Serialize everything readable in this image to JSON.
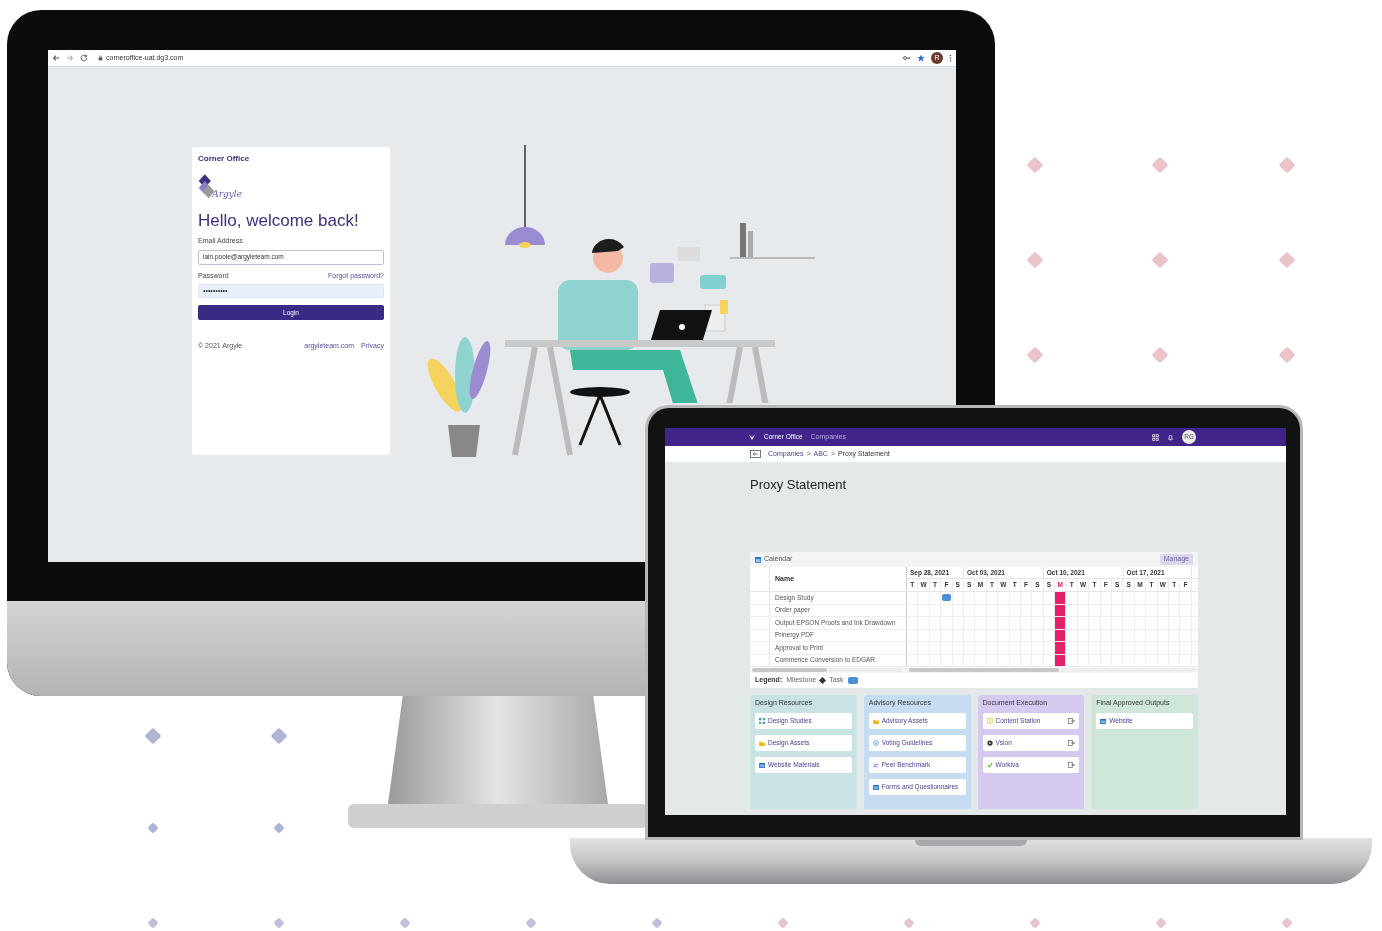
{
  "browser": {
    "url": "corneroffice-uat.dg3.com",
    "avatar": "R"
  },
  "login": {
    "brand": "Corner Office",
    "logo_text": "Argyle",
    "heading": "Hello, welcome back!",
    "email_label": "Email Address",
    "email_value": "iain.poole@argyleteam.com",
    "password_label": "Password",
    "forgot_link": "Forgot password?",
    "password_value": "••••••••••",
    "button": "Login",
    "copyright": "© 2021 Argyle",
    "footer_links": [
      "argyleteam.com",
      "Privacy"
    ]
  },
  "app": {
    "brand": "Corner Office",
    "nav": [
      "Companies"
    ],
    "avatar": "RG",
    "breadcrumbs": [
      "Companies",
      "ABC",
      "Proxy Statement"
    ],
    "separator": ">",
    "title": "Proxy Statement",
    "calendar": {
      "title": "Calendar",
      "manage_button": "Manage",
      "name_header": "Name",
      "weeks": [
        {
          "label": "Sep 28, 2021",
          "days": [
            {
              "letter": "T",
              "today": false
            },
            {
              "letter": "W",
              "today": false
            },
            {
              "letter": "T",
              "today": false
            },
            {
              "letter": "F",
              "today": false
            },
            {
              "letter": "S",
              "today": false
            }
          ]
        },
        {
          "label": "Oct 03, 2021",
          "days": [
            {
              "letter": "S",
              "today": false
            },
            {
              "letter": "M",
              "today": false
            },
            {
              "letter": "T",
              "today": false
            },
            {
              "letter": "W",
              "today": false
            },
            {
              "letter": "T",
              "today": false
            },
            {
              "letter": "F",
              "today": false
            },
            {
              "letter": "S",
              "today": false
            }
          ]
        },
        {
          "label": "Oct 10, 2021",
          "days": [
            {
              "letter": "S",
              "today": false
            },
            {
              "letter": "M",
              "today": true
            },
            {
              "letter": "T",
              "today": false
            },
            {
              "letter": "W",
              "today": false
            },
            {
              "letter": "T",
              "today": false
            },
            {
              "letter": "F",
              "today": false
            },
            {
              "letter": "S",
              "today": false
            }
          ]
        },
        {
          "label": "Oct 17, 2021",
          "days": [
            {
              "letter": "S",
              "today": false
            },
            {
              "letter": "M",
              "today": false
            },
            {
              "letter": "T",
              "today": false
            },
            {
              "letter": "W",
              "today": false
            },
            {
              "letter": "T",
              "today": false
            },
            {
              "letter": "F",
              "today": false
            }
          ]
        }
      ],
      "rows": [
        {
          "name": "Design Study",
          "cells": [
            false,
            false,
            false,
            true,
            false,
            false,
            false,
            false,
            false,
            false,
            false,
            false,
            false,
            false,
            false,
            false,
            false,
            false,
            false,
            false,
            false,
            false,
            false,
            false,
            false
          ]
        },
        {
          "name": "Order paper",
          "cells": [
            false,
            false,
            false,
            false,
            false,
            false,
            false,
            false,
            false,
            false,
            false,
            false,
            false,
            false,
            false,
            false,
            false,
            false,
            false,
            false,
            false,
            false,
            false,
            false,
            false
          ]
        },
        {
          "name": "Output EPSON Proofs and Ink Drawdown",
          "cells": [
            false,
            false,
            false,
            false,
            false,
            false,
            false,
            false,
            false,
            false,
            false,
            false,
            false,
            false,
            false,
            false,
            false,
            false,
            false,
            false,
            false,
            false,
            false,
            false,
            false
          ]
        },
        {
          "name": "Prinergy PDF",
          "cells": [
            false,
            false,
            false,
            false,
            false,
            false,
            false,
            false,
            false,
            false,
            false,
            false,
            false,
            false,
            false,
            false,
            false,
            false,
            false,
            false,
            false,
            false,
            false,
            false,
            false
          ]
        },
        {
          "name": "Approval to Print",
          "cells": [
            false,
            false,
            false,
            false,
            false,
            false,
            false,
            false,
            false,
            false,
            false,
            false,
            false,
            false,
            false,
            false,
            false,
            false,
            false,
            false,
            false,
            false,
            false,
            false,
            false
          ]
        },
        {
          "name": "Commence Conversion to EDGAR",
          "cells": [
            false,
            false,
            false,
            false,
            false,
            false,
            false,
            false,
            false,
            false,
            false,
            false,
            false,
            false,
            false,
            false,
            false,
            false,
            false,
            false,
            false,
            false,
            false,
            false,
            false
          ]
        }
      ],
      "legend": {
        "label": "Legend:",
        "items": [
          {
            "kind": "milestone",
            "label": "Milestone"
          },
          {
            "kind": "task",
            "label": "Task"
          }
        ]
      }
    },
    "lanes": [
      {
        "title": "Design Resources",
        "color": "#c9e2e4",
        "items": [
          {
            "label": "Design Studies",
            "kind": "grid",
            "external": false
          },
          {
            "label": "Design Assets",
            "kind": "folder",
            "external": false
          },
          {
            "label": "Website Materials",
            "kind": "window",
            "external": false
          }
        ]
      },
      {
        "title": "Advisory Resources",
        "color": "#c6dcf1",
        "items": [
          {
            "label": "Advisory Assets",
            "kind": "folder",
            "external": false
          },
          {
            "label": "Voting Guidelines",
            "kind": "check-circle",
            "external": false
          },
          {
            "label": "Peer Benchmark",
            "kind": "chart",
            "external": false
          },
          {
            "label": "Forms and Questionnaires",
            "kind": "window",
            "external": false
          }
        ]
      },
      {
        "title": "Document Execution",
        "color": "#d6c9f0",
        "items": [
          {
            "label": "Content Station",
            "kind": "book",
            "external": true
          },
          {
            "label": "Vsion",
            "kind": "globe",
            "external": true
          },
          {
            "label": "Workiva",
            "kind": "check",
            "external": true
          }
        ]
      },
      {
        "title": "Final Approved Outputs",
        "color": "#cfe7d8",
        "items": [
          {
            "label": "Website",
            "kind": "window",
            "external": false
          }
        ]
      }
    ]
  }
}
